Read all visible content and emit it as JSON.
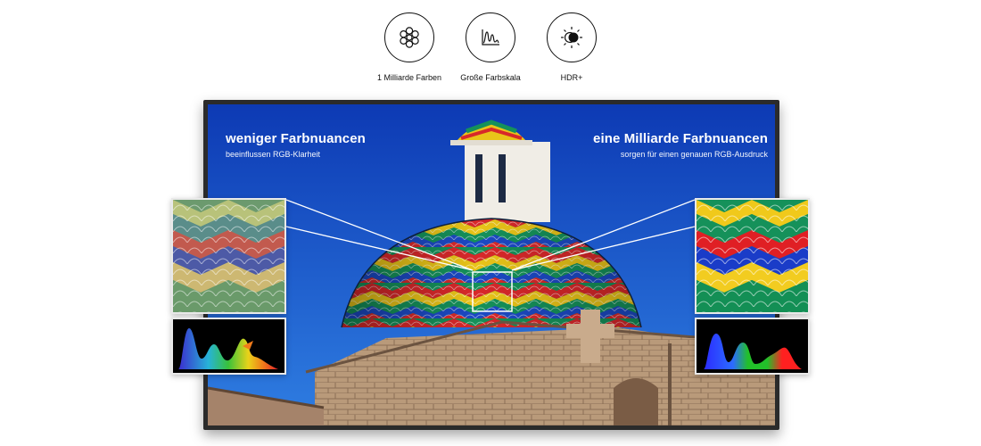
{
  "features": [
    {
      "icon": "flower-icon",
      "label": "1 Milliarde Farben"
    },
    {
      "icon": "waveform-chart-icon",
      "label": "Große Farbskala"
    },
    {
      "icon": "brightness-contrast-icon",
      "label": "HDR+"
    }
  ],
  "tv": {
    "left_caption": {
      "heading": "weniger Farbnuancen",
      "subtext": "beeinflussen RGB-Klarheit"
    },
    "right_caption": {
      "heading": "eine Milliarde Farbnuancen",
      "subtext": "sorgen für einen genauen RGB-Ausdruck"
    }
  },
  "colors": {
    "sky": "#1f63d6",
    "tv_bezel": "#2b2b2b",
    "tile_red": "#d8282a",
    "tile_yellow": "#e9c419",
    "tile_green": "#15915a",
    "tile_blue": "#1c49c4"
  }
}
